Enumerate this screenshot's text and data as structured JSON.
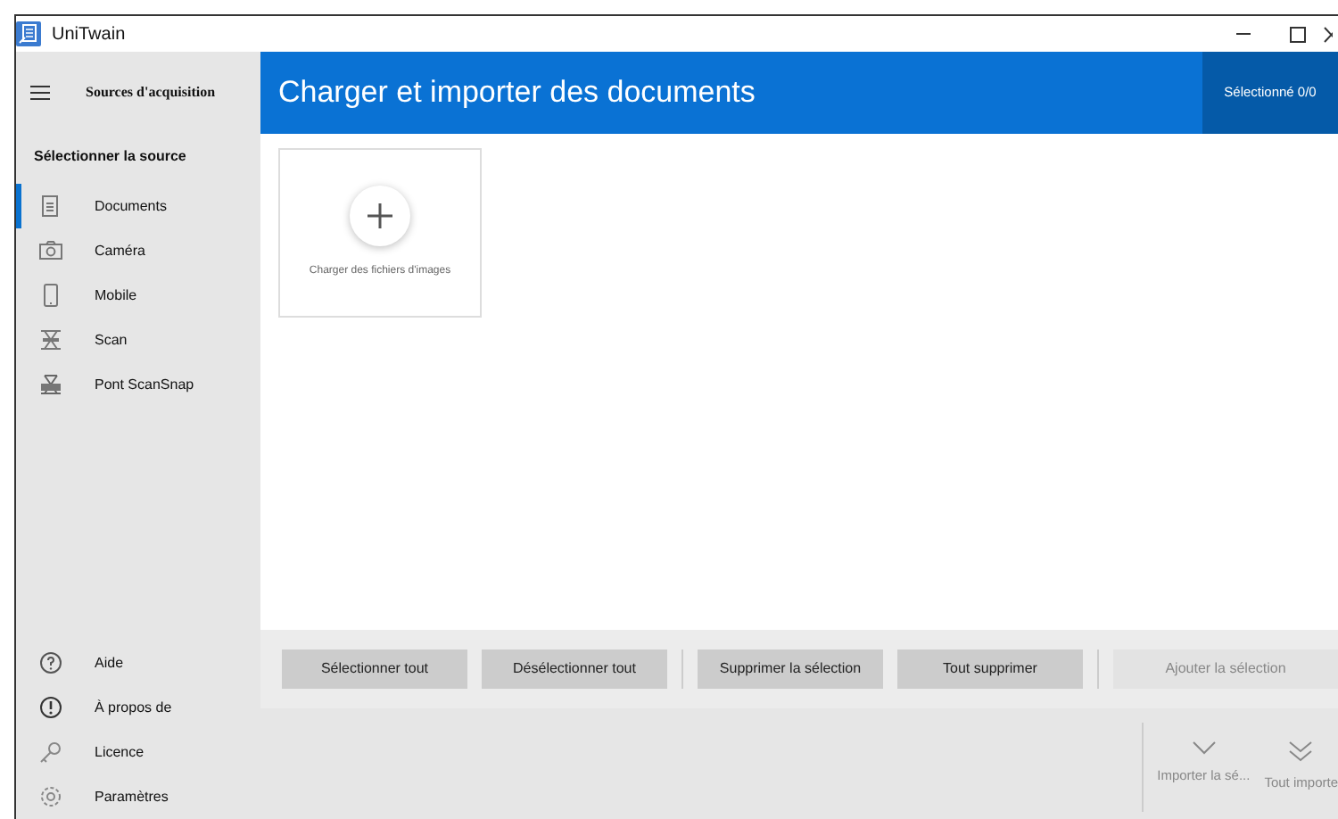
{
  "window": {
    "title": "UniTwain"
  },
  "sidebar": {
    "header": "Sources d'acquisition",
    "section_title": "Sélectionner la source",
    "items": [
      {
        "label": "Documents",
        "selected": true
      },
      {
        "label": "Caméra",
        "selected": false
      },
      {
        "label": "Mobile",
        "selected": false
      },
      {
        "label": "Scan",
        "selected": false
      },
      {
        "label": "Pont ScanSnap",
        "selected": false
      }
    ],
    "footer_items": [
      {
        "label": "Aide"
      },
      {
        "label": "À propos de"
      },
      {
        "label": "Licence"
      },
      {
        "label": "Paramètres"
      }
    ]
  },
  "header": {
    "title": "Charger et importer des documents",
    "selection_count": "Sélectionné 0/0"
  },
  "upload_tile": {
    "label": "Charger des fichiers d'images"
  },
  "actions": [
    {
      "label": "Sélectionner tout",
      "disabled": false
    },
    {
      "label": "Désélectionner tout",
      "disabled": false
    },
    {
      "label": "Supprimer la sélection",
      "disabled": false
    },
    {
      "label": "Tout supprimer",
      "disabled": false
    },
    {
      "label": "Ajouter la sélection",
      "disabled": true
    }
  ],
  "import_buttons": [
    {
      "label": "Importer la sé...",
      "disabled": true
    },
    {
      "label": "Tout importe",
      "disabled": true
    }
  ]
}
